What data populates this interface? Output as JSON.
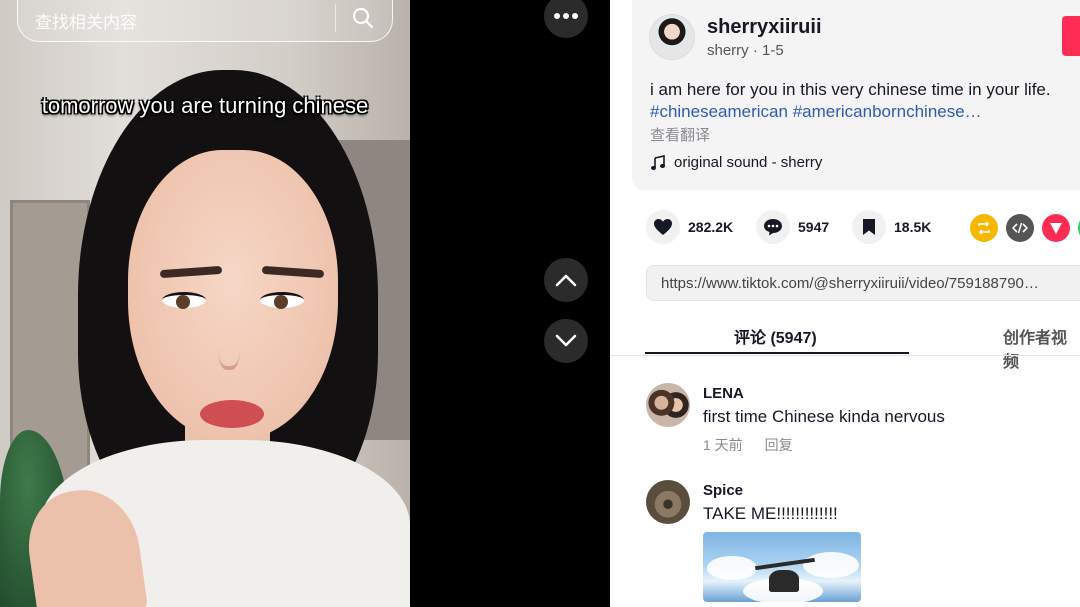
{
  "search": {
    "placeholder": "查找相关内容"
  },
  "video": {
    "caption": "tomorrow you are turning chinese"
  },
  "author": {
    "username": "sherryxiiruii",
    "display_name": "sherry",
    "date": "1-5",
    "subline": "sherry · 1-5"
  },
  "description": {
    "text": "i am here for you in this very chinese time in your life.",
    "hashtags": "#chineseamerican #americanbornchinese…",
    "translate_label": "查看翻译"
  },
  "sound": {
    "label": "original sound - sherry",
    "icon": "music-note-icon"
  },
  "stats": {
    "likes": "282.2K",
    "comments": "5947",
    "saves": "18.5K"
  },
  "share_icons": [
    "repost-icon",
    "embed-icon",
    "send-icon"
  ],
  "link": {
    "url": "https://www.tiktok.com/@sherryxiiruii/video/759188790…"
  },
  "tabs": [
    {
      "label": "评论 (5947)",
      "active": true
    },
    {
      "label": "创作者视频",
      "active": false
    }
  ],
  "comments": [
    {
      "user": "LENA",
      "text": "first time Chinese kinda nervous",
      "time": "1 天前",
      "reply_label": "回复"
    },
    {
      "user": "Spice",
      "text": "TAKE ME!!!!!!!!!!!!!",
      "has_image": true
    }
  ],
  "colors": {
    "accent": "#fe2c55",
    "hashtag": "#2b5db8",
    "repost": "#f5b800",
    "embed": "#555555",
    "send": "#fe2c55"
  }
}
